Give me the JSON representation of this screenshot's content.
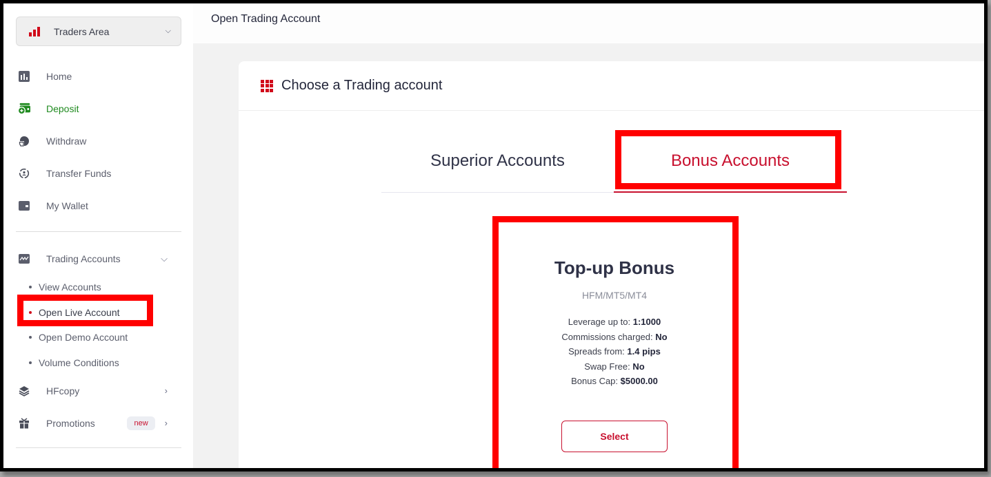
{
  "sidebar": {
    "area_selector": {
      "label": "Traders Area",
      "icon": "signal-bars-icon"
    },
    "items": [
      {
        "label": "Home",
        "icon": "chart-icon"
      },
      {
        "label": "Deposit",
        "icon": "wallet-plus-icon"
      },
      {
        "label": "Withdraw",
        "icon": "withdraw-icon"
      },
      {
        "label": "Transfer Funds",
        "icon": "transfer-icon"
      },
      {
        "label": "My Wallet",
        "icon": "wallet-icon"
      }
    ],
    "trading_accounts": {
      "label": "Trading Accounts",
      "icon": "trading-chart-icon",
      "sub_items": [
        {
          "label": "View Accounts"
        },
        {
          "label": "Open Live Account",
          "active": true
        },
        {
          "label": "Open Demo Account"
        },
        {
          "label": "Volume Conditions"
        }
      ]
    },
    "hfcopy": {
      "label": "HFcopy",
      "icon": "layers-icon"
    },
    "promotions": {
      "label": "Promotions",
      "icon": "gift-icon",
      "badge": "new"
    }
  },
  "header": {
    "title": "Open Trading Account"
  },
  "card": {
    "title": "Choose a Trading account",
    "tabs": [
      {
        "label": "Superior Accounts",
        "active": false
      },
      {
        "label": "Bonus Accounts",
        "active": true
      }
    ],
    "account": {
      "name": "Top-up Bonus",
      "platforms": "HFM/MT5/MT4",
      "specs": [
        {
          "label": "Leverage up to:",
          "value": "1:1000"
        },
        {
          "label": "Commissions charged:",
          "value": "No"
        },
        {
          "label": "Spreads from:",
          "value": "1.4 pips"
        },
        {
          "label": "Swap Free:",
          "value": "No"
        },
        {
          "label": "Bonus Cap:",
          "value": "$5000.00"
        }
      ],
      "select_label": "Select"
    }
  },
  "colors": {
    "accent": "#c8102e",
    "deposit_green": "#1f8a1f",
    "highlight": "#ff0000"
  }
}
